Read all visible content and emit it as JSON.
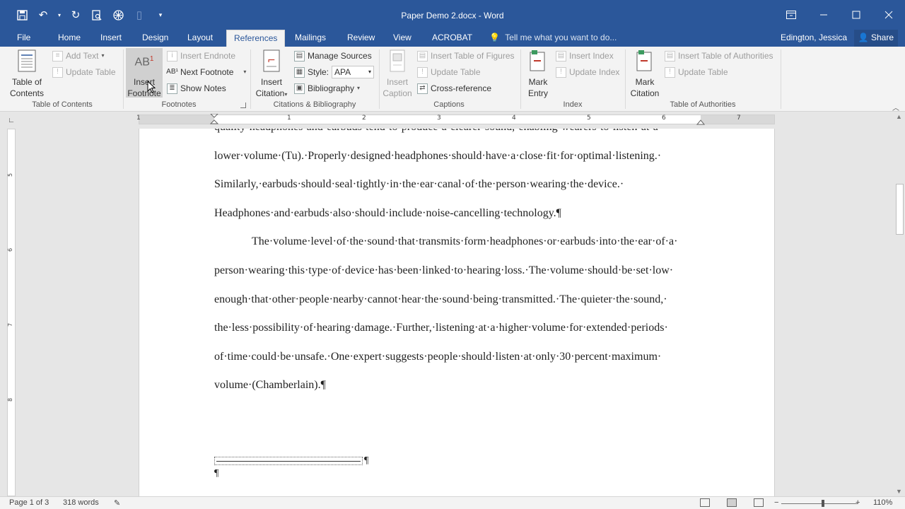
{
  "window": {
    "title": "Paper Demo 2.docx - Word",
    "controls": [
      "ribbon-display-icon",
      "minimize-icon",
      "maximize-icon",
      "close-icon"
    ]
  },
  "quick_access": [
    "save-icon",
    "undo-icon",
    "redo-icon",
    "print-preview-icon",
    "touch-mode-icon",
    "customize-icon"
  ],
  "tabs": [
    "File",
    "Home",
    "Insert",
    "Design",
    "Layout",
    "References",
    "Mailings",
    "Review",
    "View",
    "ACROBAT"
  ],
  "active_tab": "References",
  "tell_me": "Tell me what you want to do...",
  "user": "Edington, Jessica",
  "share": "Share",
  "ribbon": {
    "toc": {
      "big": "Table of Contents",
      "add_text": "Add Text",
      "update_table": "Update Table",
      "label": "Table of Contents"
    },
    "footnotes": {
      "insert_footnote": "Insert Footnote",
      "insert_endnote": "Insert Endnote",
      "next_footnote": "Next Footnote",
      "show_notes": "Show Notes",
      "label": "Footnotes"
    },
    "citations": {
      "insert_citation": "Insert Citation",
      "manage_sources": "Manage Sources",
      "style_label": "Style:",
      "style_value": "APA",
      "bibliography": "Bibliography",
      "label": "Citations & Bibliography"
    },
    "captions": {
      "insert_caption": "Insert Caption",
      "insert_tof": "Insert Table of Figures",
      "update_table": "Update Table",
      "cross_reference": "Cross-reference",
      "label": "Captions"
    },
    "index": {
      "mark_entry": "Mark Entry",
      "insert_index": "Insert Index",
      "update_index": "Update Index",
      "label": "Index"
    },
    "toa": {
      "mark_citation": "Mark Citation",
      "insert_toa": "Insert Table of Authorities",
      "update_table": "Update Table",
      "label": "Table of Authorities"
    }
  },
  "ruler": {
    "numbers": [
      "1",
      "1",
      "2",
      "3",
      "4",
      "5",
      "6",
      "7"
    ],
    "vertical_numbers": [
      "5",
      "6",
      "7",
      "8"
    ]
  },
  "document": {
    "lines": [
      "quality·headphones·and·earbuds·tend·to·produce·a·clearer·sound,·enabling·wearers·to·listen·at·a·",
      "lower·volume·(Tu).·Properly·designed·headphones·should·have·a·close·fit·for·optimal·listening.·",
      "Similarly,·earbuds·should·seal·tightly·in·the·ear·canal·of·the·person·wearing·the·device.·",
      "Headphones·and·earbuds·also·should·include·noise-cancelling·technology.¶",
      "The·volume·level·of·the·sound·that·transmits·form·headphones·or·earbuds·into·the·ear·of·a·",
      "person·wearing·this·type·of·device·has·been·linked·to·hearing·loss.·The·volume·should·be·set·low·",
      "enough·that·other·people·nearby·cannot·hear·the·sound·being·transmitted.·The·quieter·the·sound,·",
      "the·less·possibility·of·hearing·damage.·Further,·listening·at·a·higher·volume·for·extended·periods·",
      "of·time·could·be·unsafe.·One·expert·suggests·people·should·listen·at·only·30·percent·maximum·",
      "volume·(Chamberlain).¶"
    ],
    "footnote_separator_mark": "¶",
    "footnote_mark": "¶"
  },
  "status": {
    "page": "Page 1 of 3",
    "words": "318 words",
    "zoom": "110%",
    "zoom_level": 0.55
  }
}
